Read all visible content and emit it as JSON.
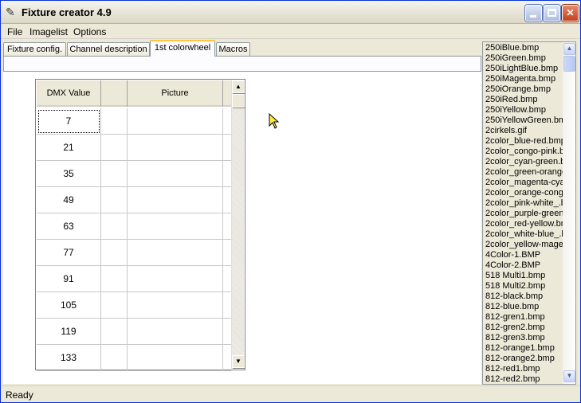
{
  "window": {
    "title": "Fixture creator 4.9",
    "icon": "app-icon",
    "buttons": {
      "minimize": "minimize-icon",
      "maximize": "maximize-icon",
      "close_glyph": "✕"
    }
  },
  "menu": [
    "File",
    "Imagelist",
    "Options"
  ],
  "tabs": [
    {
      "label": "Fixture config.",
      "active": false
    },
    {
      "label": "Channel description",
      "active": false
    },
    {
      "label": "1st colorwheel",
      "active": true
    },
    {
      "label": "Macros",
      "active": false
    }
  ],
  "grid": {
    "headers": [
      "DMX Value",
      "",
      "Picture"
    ],
    "rows": [
      {
        "dmx": "7"
      },
      {
        "dmx": "21"
      },
      {
        "dmx": "35"
      },
      {
        "dmx": "49"
      },
      {
        "dmx": "63"
      },
      {
        "dmx": "77"
      },
      {
        "dmx": "91"
      },
      {
        "dmx": "105"
      },
      {
        "dmx": "119"
      },
      {
        "dmx": "133"
      }
    ],
    "scroll_up_glyph": "▲",
    "scroll_down_glyph": "▼"
  },
  "imagelist": {
    "items": [
      "250iBlue.bmp",
      "250iGreen.bmp",
      "250iLightBlue.bmp",
      "250iMagenta.bmp",
      "250iOrange.bmp",
      "250iRed.bmp",
      "250iYellow.bmp",
      "250iYellowGreen.bm",
      "2cirkels.gif",
      "2color_blue-red.bmp",
      "2color_congo-pink.b",
      "2color_cyan-green.b",
      "2color_green-orange",
      "2color_magenta-cya",
      "2color_orange-cong",
      "2color_pink-white_.b",
      "2color_purple-green.",
      "2color_red-yellow.bn",
      "2color_white-blue_.b",
      "2color_yellow-mager",
      "4Color-1.BMP",
      "4Color-2.BMP",
      "518 Multi1.bmp",
      "518 Multi2.bmp",
      "812-black.bmp",
      "812-blue.bmp",
      "812-gren1.bmp",
      "812-gren2.bmp",
      "812-gren3.bmp",
      "812-orange1.bmp",
      "812-orange2.bmp",
      "812-red1.bmp",
      "812-red2.bmp"
    ],
    "scroll_up_glyph": "▲",
    "scroll_down_glyph": "▼"
  },
  "status": {
    "text": "Ready"
  },
  "colors": {
    "title_bar": "#ece9d8",
    "active_tab_border": "#ffc73c",
    "close_button": "#c3401c"
  }
}
